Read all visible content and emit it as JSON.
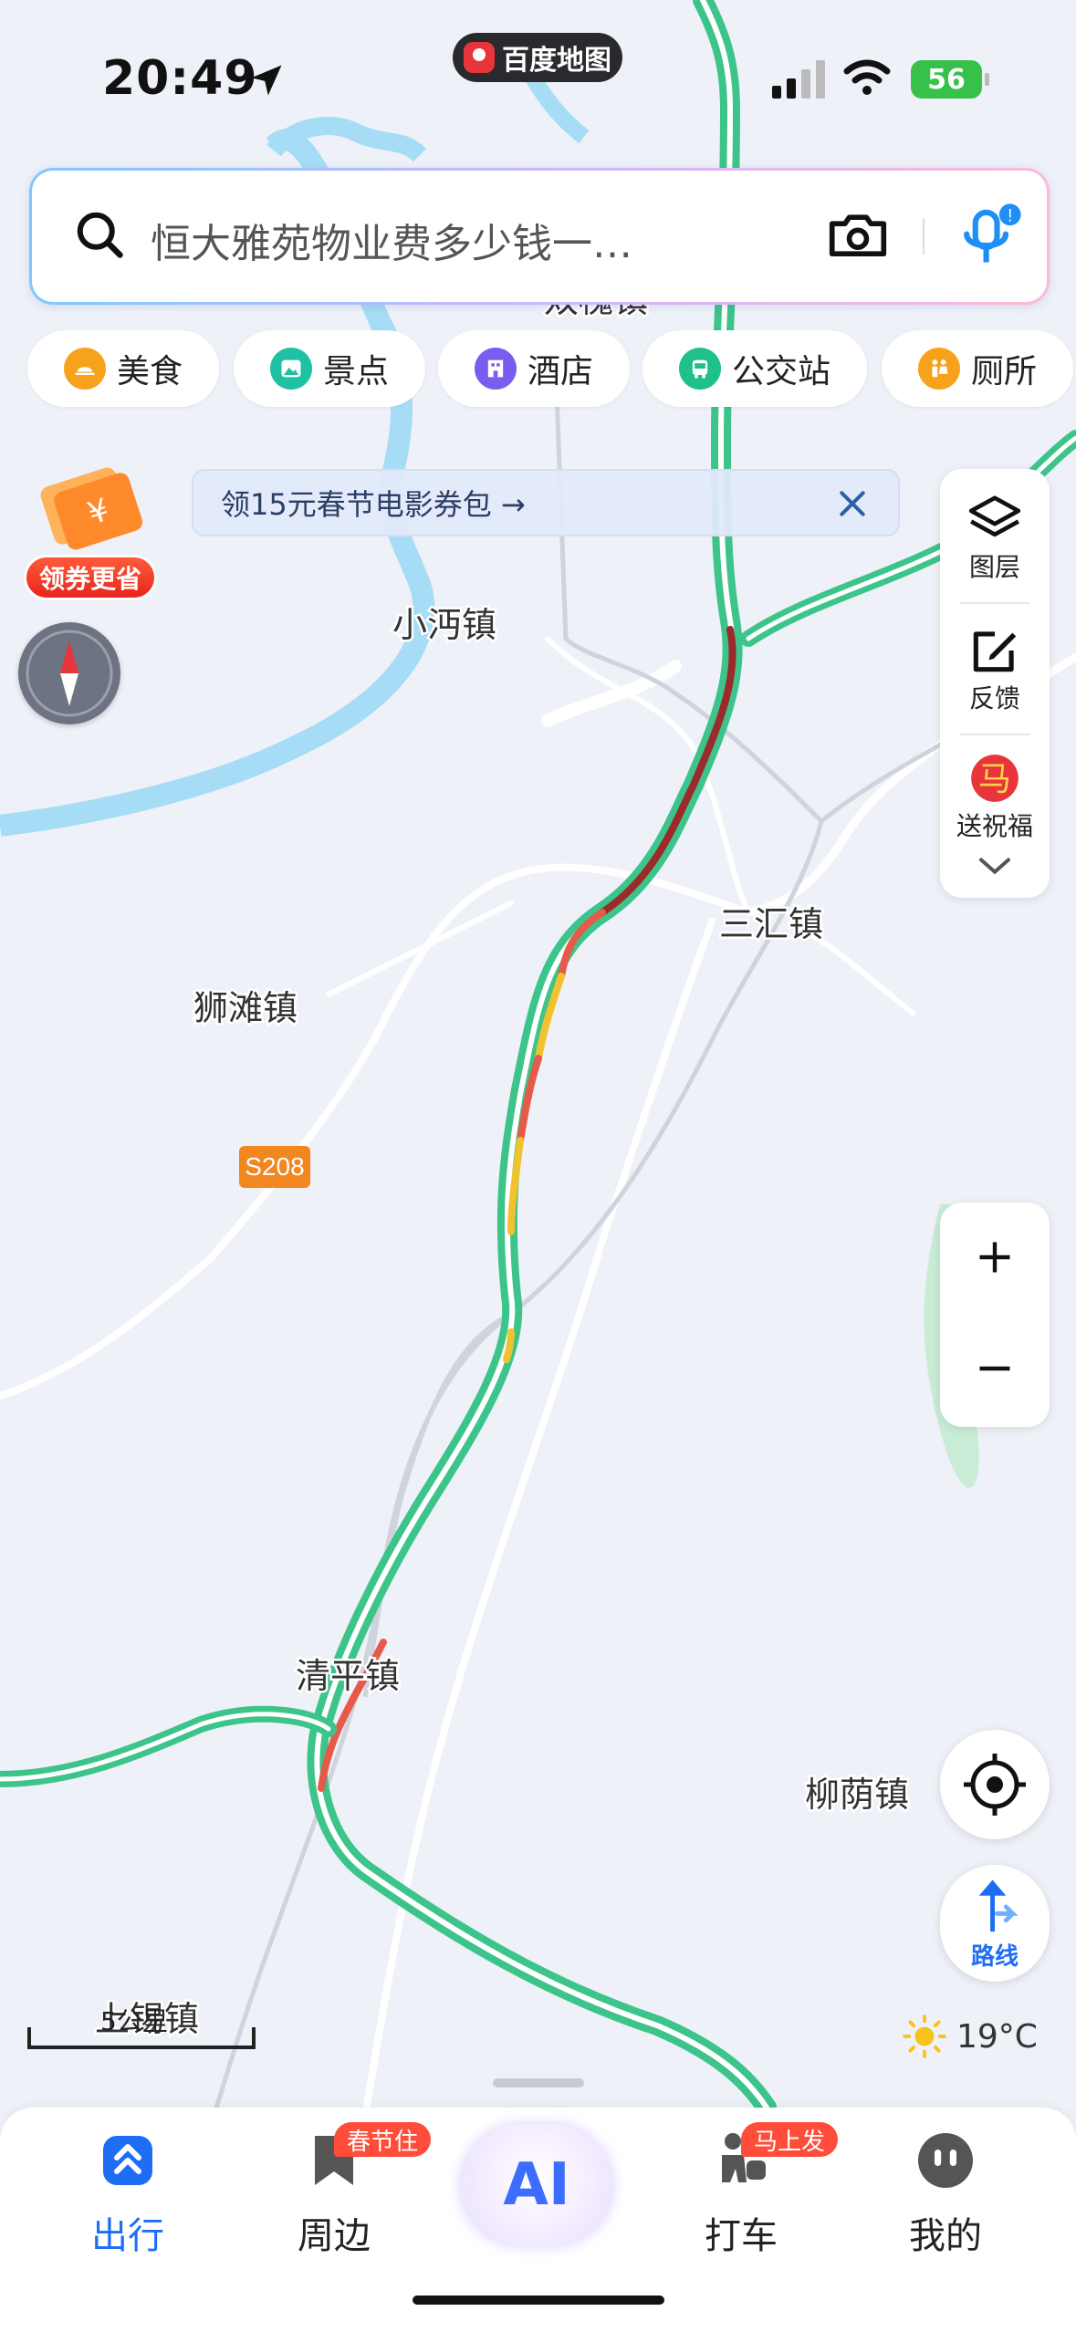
{
  "status_bar": {
    "time": "20:49",
    "app_name": "百度地图",
    "battery": "56"
  },
  "search": {
    "placeholder": "恒大雅苑物业费多少钱一…"
  },
  "categories": [
    {
      "label": "美食",
      "color": "#f7a21b",
      "icon": "food-icon"
    },
    {
      "label": "景点",
      "color": "#1fc0a3",
      "icon": "scenic-icon"
    },
    {
      "label": "酒店",
      "color": "#7a5cf0",
      "icon": "hotel-icon"
    },
    {
      "label": "公交站",
      "color": "#1fc08a",
      "icon": "bus-icon"
    },
    {
      "label": "厕所",
      "color": "#f7a21b",
      "icon": "toilet-icon"
    }
  ],
  "banner": {
    "text": "领15元春节电影券包 →"
  },
  "coupon": {
    "label": "领券更省"
  },
  "toolbar": {
    "layers_label": "图层",
    "feedback_label": "反馈",
    "blessing_label": "送祝福",
    "blessing_glyph": "马"
  },
  "map": {
    "towns": [
      {
        "name": "小沔镇"
      },
      {
        "name": "三汇镇"
      },
      {
        "name": "狮滩镇"
      },
      {
        "name": "清平镇"
      },
      {
        "name": "柳荫镇"
      },
      {
        "name": "上锡镇"
      },
      {
        "name": "双槐镇"
      }
    ],
    "road_shield": "S208",
    "traffic_colors": {
      "smooth": "#3cc48a",
      "slow": "#f2c12e",
      "congested": "#e65a4a",
      "severe": "#9b2a2a"
    },
    "river_color": "#a6dcf5"
  },
  "scale": {
    "label": "5公里"
  },
  "weather": {
    "temperature": "19°C",
    "icon": "sun-icon"
  },
  "route_button": {
    "label": "路线"
  },
  "bottom_nav": [
    {
      "label": "出行",
      "active": true
    },
    {
      "label": "周边",
      "badge": "春节住"
    },
    {
      "label": "AI"
    },
    {
      "label": "打车",
      "badge": "马上发"
    },
    {
      "label": "我的"
    }
  ],
  "accent_color": "#1e6ef5"
}
